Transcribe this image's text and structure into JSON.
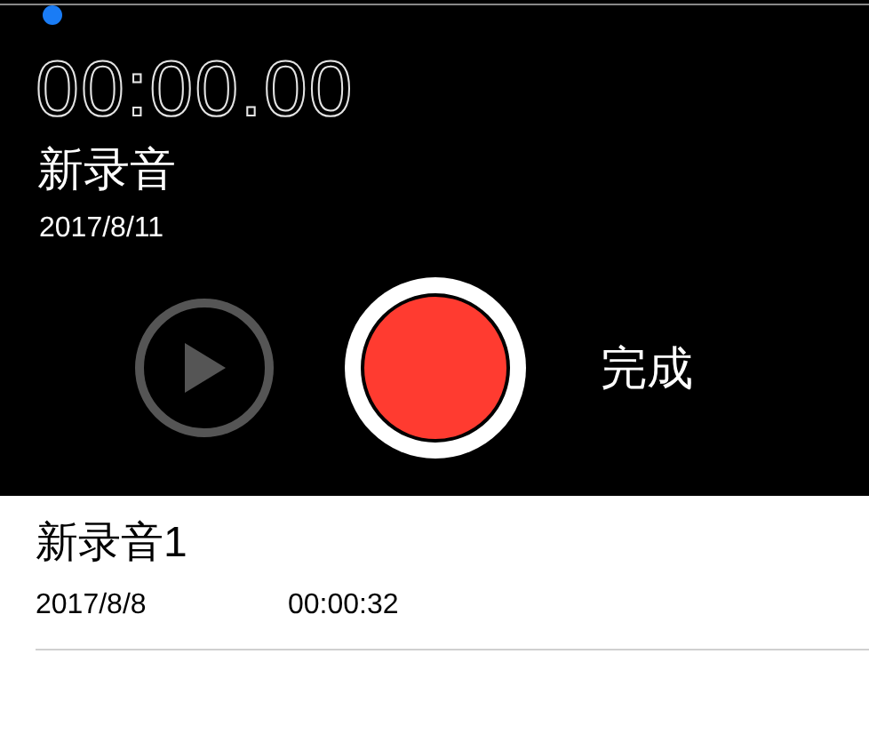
{
  "recorder": {
    "timer": "00:00.00",
    "title": "新录音",
    "date": "2017/8/11",
    "play_button": {
      "disabled": true
    },
    "done_button": "完成"
  },
  "recordings": [
    {
      "title": "新录音1",
      "date": "2017/8/8",
      "duration": "00:00:32"
    }
  ]
}
